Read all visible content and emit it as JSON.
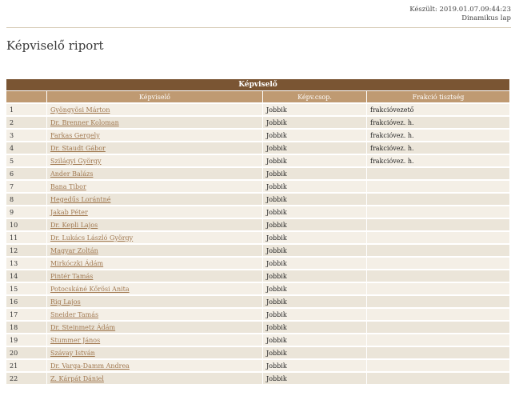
{
  "header": {
    "generated": "Készült: 2019.01.07.09:44:23",
    "page_type": "Dinamikus lap"
  },
  "title": "Képviselő riport",
  "table": {
    "group_header": "Képviselő",
    "columns": [
      "",
      "Képviselő",
      "Képv.csop.",
      "Frakció tisztség"
    ],
    "rows": [
      {
        "n": "1",
        "name": "Gyöngyösi Márton",
        "group": "Jobbik",
        "role": "frakcióvezető"
      },
      {
        "n": "2",
        "name": "Dr. Brenner Koloman",
        "group": "Jobbik",
        "role": "frakcióvez. h."
      },
      {
        "n": "3",
        "name": "Farkas Gergely",
        "group": "Jobbik",
        "role": "frakcióvez. h."
      },
      {
        "n": "4",
        "name": "Dr. Staudt Gábor",
        "group": "Jobbik",
        "role": "frakcióvez. h."
      },
      {
        "n": "5",
        "name": "Szilágyi György",
        "group": "Jobbik",
        "role": "frakcióvez. h."
      },
      {
        "n": "6",
        "name": "Ander Balázs",
        "group": "Jobbik",
        "role": ""
      },
      {
        "n": "7",
        "name": "Bana Tibor",
        "group": "Jobbik",
        "role": ""
      },
      {
        "n": "8",
        "name": "Hegedűs Lorántné",
        "group": "Jobbik",
        "role": ""
      },
      {
        "n": "9",
        "name": "Jakab Péter",
        "group": "Jobbik",
        "role": ""
      },
      {
        "n": "10",
        "name": "Dr. Kepli Lajos",
        "group": "Jobbik",
        "role": ""
      },
      {
        "n": "11",
        "name": "Dr. Lukács László György",
        "group": "Jobbik",
        "role": ""
      },
      {
        "n": "12",
        "name": "Magyar Zoltán",
        "group": "Jobbik",
        "role": ""
      },
      {
        "n": "13",
        "name": "Mirkóczki Ádám",
        "group": "Jobbik",
        "role": ""
      },
      {
        "n": "14",
        "name": "Pintér Tamás",
        "group": "Jobbik",
        "role": ""
      },
      {
        "n": "15",
        "name": "Potocskáné Kőrösi Anita",
        "group": "Jobbik",
        "role": ""
      },
      {
        "n": "16",
        "name": "Rig Lajos",
        "group": "Jobbik",
        "role": ""
      },
      {
        "n": "17",
        "name": "Sneider Tamás",
        "group": "Jobbik",
        "role": ""
      },
      {
        "n": "18",
        "name": "Dr. Steinmetz Ádám",
        "group": "Jobbik",
        "role": ""
      },
      {
        "n": "19",
        "name": "Stummer János",
        "group": "Jobbik",
        "role": ""
      },
      {
        "n": "20",
        "name": "Szávay István",
        "group": "Jobbik",
        "role": ""
      },
      {
        "n": "21",
        "name": "Dr. Varga-Damm Andrea",
        "group": "Jobbik",
        "role": ""
      },
      {
        "n": "22",
        "name": "Z. Kárpát Dániel",
        "group": "Jobbik",
        "role": ""
      }
    ]
  },
  "colors": {
    "group_header_bg": "#7a5533",
    "column_header_bg": "#bf9a72",
    "link": "#a07850",
    "row_bg": "#f4efe6",
    "row_alt_bg": "#ebe5d9"
  }
}
